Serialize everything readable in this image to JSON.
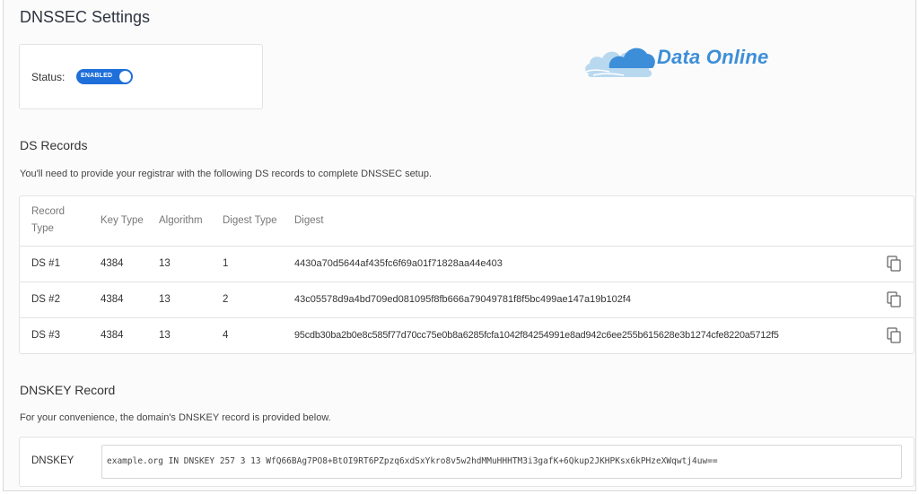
{
  "page": {
    "title": "DNSSEC Settings"
  },
  "status": {
    "label": "Status:",
    "toggle_text": "ENABLED",
    "enabled": true
  },
  "logo": {
    "text": "Data Online"
  },
  "ds_records": {
    "title": "DS Records",
    "description": "You'll need to provide your registrar with the following DS records to complete DNSSEC setup.",
    "columns": [
      "Record Type",
      "Key Type",
      "Algorithm",
      "Digest Type",
      "Digest"
    ],
    "rows": [
      {
        "record_type": "DS #1",
        "key_type": "4384",
        "algorithm": "13",
        "digest_type": "1",
        "digest": "4430a70d5644af435fc6f69a01f71828aa44e403"
      },
      {
        "record_type": "DS #2",
        "key_type": "4384",
        "algorithm": "13",
        "digest_type": "2",
        "digest": "43c05578d9a4bd709ed081095f8fb666a79049781f8f5bc499ae147a19b102f4"
      },
      {
        "record_type": "DS #3",
        "key_type": "4384",
        "algorithm": "13",
        "digest_type": "4",
        "digest": "95cdb30ba2b0e8c585f77d70cc75e0b8a6285fcfa1042f84254991e8ad942c6ee255b615628e3b1274cfe8220a5712f5"
      }
    ]
  },
  "dnskey": {
    "title": "DNSKEY Record",
    "description": "For your convenience, the domain's DNSKEY record is provided below.",
    "label": "DNSKEY",
    "value": "example.org IN DNSKEY 257 3 13 WfQ66BAg7PO8+BtOI9RT6PZpzq6xdSxYkro8v5w2hdMMuHHHTM3i3gafK+6Qkup2JKHPKsx6kPHzeXWqwtj4uw=="
  },
  "colors": {
    "accent": "#1e6fd9",
    "logo": "#3d8ed8"
  },
  "icons": {
    "copy": "copy-icon",
    "logo": "cloud-logo-icon"
  }
}
